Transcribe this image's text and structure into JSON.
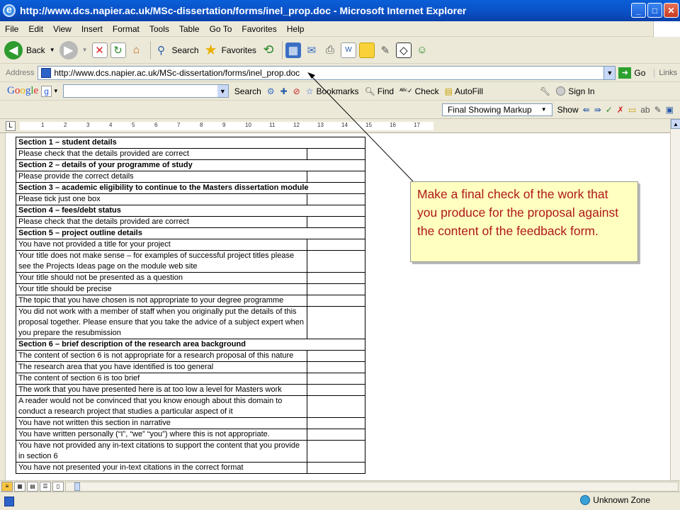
{
  "window": {
    "title": "http://www.dcs.napier.ac.uk/MSc-dissertation/forms/inel_prop.doc - Microsoft Internet Explorer"
  },
  "menu": [
    "File",
    "Edit",
    "View",
    "Insert",
    "Format",
    "Tools",
    "Table",
    "Go To",
    "Favorites",
    "Help"
  ],
  "toolbar": {
    "back": "Back",
    "search": "Search",
    "favorites": "Favorites"
  },
  "address": {
    "label": "Address",
    "url": "http://www.dcs.napier.ac.uk/MSc-dissertation/forms/inel_prop.doc",
    "go": "Go",
    "links": "Links"
  },
  "google": {
    "logo": "Google",
    "g_icon": "g",
    "search": "Search",
    "bookmarks": "Bookmarks",
    "find": "Find",
    "check": "Check",
    "autofill": "AutoFill",
    "signin": "Sign In"
  },
  "word": {
    "markup": "Final Showing Markup",
    "show": "Show"
  },
  "ruler": [
    "1",
    "2",
    "3",
    "4",
    "5",
    "6",
    "7",
    "8",
    "9",
    "10",
    "11",
    "12",
    "13",
    "14",
    "15",
    "16",
    "17"
  ],
  "form": {
    "rows": [
      {
        "text": "Section 1 – student details",
        "type": "header"
      },
      {
        "text": "Please check that the details provided are correct",
        "type": "item"
      },
      {
        "text": "Section 2 – details of your programme of study",
        "type": "header"
      },
      {
        "text": "Please provide the correct details",
        "type": "item"
      },
      {
        "text": "Section 3 – academic eligibility to continue to the Masters dissertation module",
        "type": "header"
      },
      {
        "text": "Please tick just one box",
        "type": "item"
      },
      {
        "text": "Section 4 – fees/debt status",
        "type": "header"
      },
      {
        "text": "Please check that the details provided are correct",
        "type": "item"
      },
      {
        "text": "Section 5 – project outline details",
        "type": "header"
      },
      {
        "text": "You have not provided a title for your project",
        "type": "item"
      },
      {
        "text": "Your title does not make sense – for examples of successful project titles please see the Projects Ideas page on the module web site",
        "type": "item"
      },
      {
        "text": "Your title should not be presented as a question",
        "type": "item"
      },
      {
        "text": "Your title should be precise",
        "type": "item"
      },
      {
        "text": "The topic that you have chosen is not appropriate to your degree programme",
        "type": "item"
      },
      {
        "text": "You did not work with a member of staff when you originally put the details of this proposal together. Please ensure that you take the advice of a subject expert when you prepare the resubmission",
        "type": "item"
      },
      {
        "text": "Section 6 – brief description of the research area background",
        "type": "header"
      },
      {
        "text": "The content of section 6 is not appropriate for a research proposal of this nature",
        "type": "item"
      },
      {
        "text": "The research area that you have identified is too general",
        "type": "item"
      },
      {
        "text": "The content of section 6 is too brief",
        "type": "item"
      },
      {
        "text": "The work that you have presented here is at too low a level for Masters work",
        "type": "item"
      },
      {
        "text": "A reader would not be convinced that you know enough about this domain to conduct a research project that studies a particular aspect of it",
        "type": "item"
      },
      {
        "text": "You have not written this section in narrative",
        "type": "item"
      },
      {
        "text": "You have written personally (“I”, “we” “you”) where this is not appropriate.",
        "type": "item"
      },
      {
        "text": "You have not provided any in-text citations to support the content that you provide in section 6",
        "type": "item"
      },
      {
        "text": "You have not presented your in-text citations in the correct format",
        "type": "item"
      }
    ]
  },
  "callout": {
    "text": "Make a final check of the work that you produce for the proposal against the content of the feedback form."
  },
  "status": {
    "zone": "Unknown Zone"
  }
}
